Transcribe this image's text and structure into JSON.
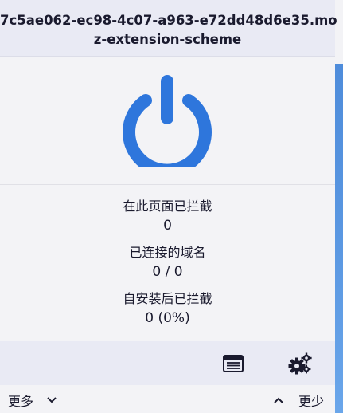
{
  "header": {
    "hostname_line1": "7c5ae062-ec98-4c07-a963-e72dd48d6e35.mo",
    "hostname_line2": "z-extension-scheme"
  },
  "power_button": {
    "icon": "power-icon",
    "color": "#2e76dc"
  },
  "stats": {
    "blocked_on_page_label": "在此页面已拦截",
    "blocked_on_page_value": "0",
    "domains_connected_label": "已连接的域名",
    "domains_connected_value": "0 / 0",
    "blocked_since_install_label": "自安装后已拦截",
    "blocked_since_install_value": "0 (0%)"
  },
  "toolbar": {
    "logger_icon": "logger-icon",
    "dashboard_icon": "gears-icon"
  },
  "footer": {
    "more_label": "更多",
    "less_label": "更少"
  },
  "colors": {
    "accent": "#2e76dc",
    "header_bg": "#e9eaf4",
    "panel_bg": "#f3f3f6"
  }
}
